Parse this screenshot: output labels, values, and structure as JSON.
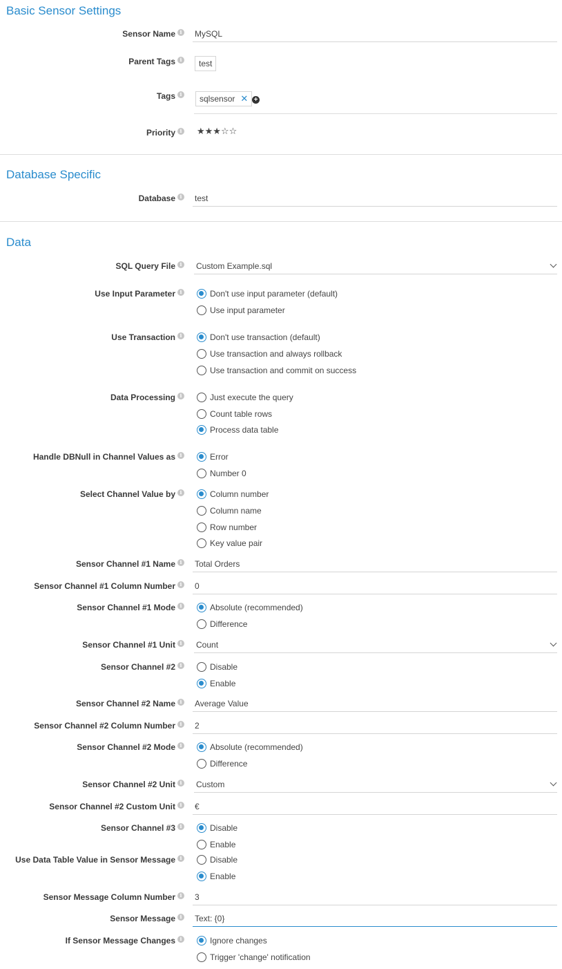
{
  "sections": {
    "basic": "Basic Sensor Settings",
    "database": "Database Specific",
    "data": "Data"
  },
  "icons": {
    "info": "info-icon",
    "add": "plus-circle-icon",
    "remove": "close-icon",
    "dropdown": "chevron-down-icon"
  },
  "colors": {
    "accent": "#2a8ccd"
  },
  "basic": {
    "sensor_name_label": "Sensor Name",
    "sensor_name_value": "MySQL",
    "parent_tags_label": "Parent Tags",
    "parent_tags_value": "test",
    "tags_label": "Tags",
    "tag_value": "sqlsensor",
    "tag_remove": "✕",
    "tag_add": "+",
    "priority_label": "Priority",
    "priority_stars": "★★★☆☆",
    "priority_value": 3
  },
  "database": {
    "database_label": "Database",
    "database_value": "test"
  },
  "data": {
    "sql_query_file_label": "SQL Query File",
    "sql_query_file_value": "Custom Example.sql",
    "use_input_parameter_label": "Use Input Parameter",
    "use_input_parameter_options": [
      "Don't use input parameter (default)",
      "Use input parameter"
    ],
    "use_transaction_label": "Use Transaction",
    "use_transaction_options": [
      "Don't use transaction (default)",
      "Use transaction and always rollback",
      "Use transaction and commit on success"
    ],
    "data_processing_label": "Data Processing",
    "data_processing_options": [
      "Just execute the query",
      "Count table rows",
      "Process data table"
    ],
    "handle_dbnull_label": "Handle DBNull in Channel Values as",
    "handle_dbnull_options": [
      "Error",
      "Number 0"
    ],
    "select_channel_label": "Select Channel Value by",
    "select_channel_options": [
      "Column number",
      "Column name",
      "Row number",
      "Key value pair"
    ],
    "ch1_name_label": "Sensor Channel #1 Name",
    "ch1_name_value": "Total Orders",
    "ch1_col_label": "Sensor Channel #1 Column Number",
    "ch1_col_value": "0",
    "ch1_mode_label": "Sensor Channel #1 Mode",
    "ch1_mode_options": [
      "Absolute (recommended)",
      "Difference"
    ],
    "ch1_unit_label": "Sensor Channel #1 Unit",
    "ch1_unit_value": "Count",
    "ch2_label": "Sensor Channel #2",
    "ch2_options": [
      "Disable",
      "Enable"
    ],
    "ch2_name_label": "Sensor Channel #2 Name",
    "ch2_name_value": "Average Value",
    "ch2_col_label": "Sensor Channel #2 Column Number",
    "ch2_col_value": "2",
    "ch2_mode_label": "Sensor Channel #2 Mode",
    "ch2_mode_options": [
      "Absolute (recommended)",
      "Difference"
    ],
    "ch2_unit_label": "Sensor Channel #2 Unit",
    "ch2_unit_value": "Custom",
    "ch2_custom_unit_label": "Sensor Channel #2 Custom Unit",
    "ch2_custom_unit_value": "€",
    "ch3_label": "Sensor Channel #3",
    "ch3_options": [
      "Disable",
      "Enable"
    ],
    "use_dt_msg_label": "Use Data Table Value in Sensor Message",
    "use_dt_msg_options": [
      "Disable",
      "Enable"
    ],
    "msg_col_label": "Sensor Message Column Number",
    "msg_col_value": "3",
    "msg_label": "Sensor Message",
    "msg_value": "Text: {0}",
    "msg_changes_label": "If Sensor Message Changes",
    "msg_changes_options": [
      "Ignore changes",
      "Trigger 'change' notification"
    ]
  }
}
